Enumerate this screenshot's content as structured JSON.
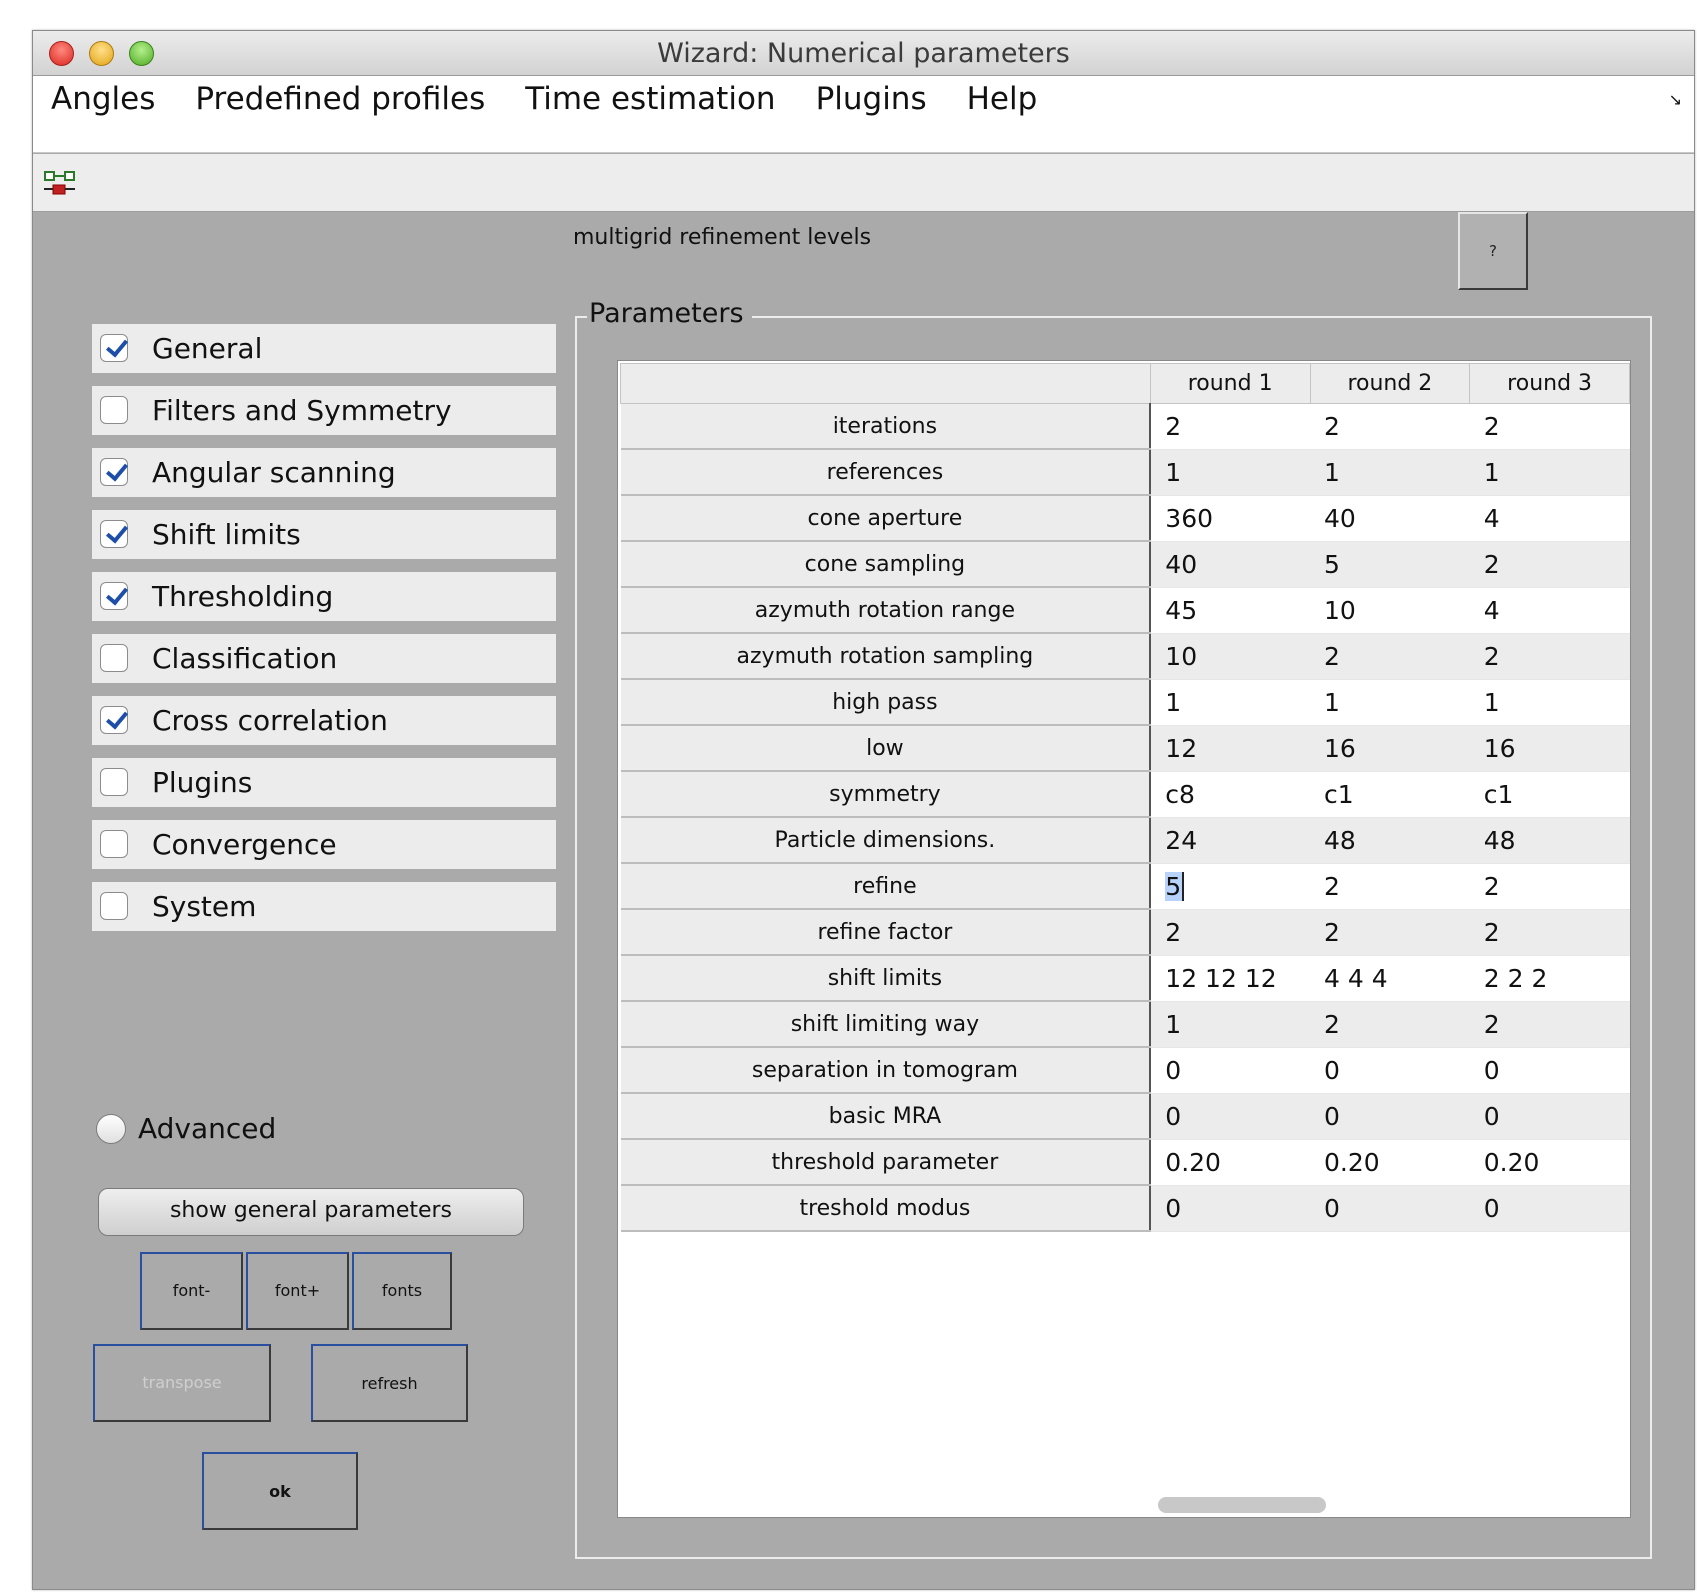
{
  "window": {
    "title": "Wizard: Numerical parameters"
  },
  "menu": {
    "items": [
      "Angles",
      "Predefined profiles",
      "Time estimation",
      "Plugins",
      "Help"
    ]
  },
  "toolbar": {
    "icon": "node-link-icon"
  },
  "header": {
    "multigrid_label": "multigrid refinement levels",
    "help_label": "?"
  },
  "categories": [
    {
      "label": "General",
      "checked": true
    },
    {
      "label": "Filters and Symmetry",
      "checked": false
    },
    {
      "label": "Angular scanning",
      "checked": true
    },
    {
      "label": "Shift limits",
      "checked": true
    },
    {
      "label": "Thresholding",
      "checked": true
    },
    {
      "label": "Classification",
      "checked": false
    },
    {
      "label": "Cross correlation",
      "checked": true
    },
    {
      "label": "Plugins",
      "checked": false
    },
    {
      "label": "Convergence",
      "checked": false
    },
    {
      "label": "System",
      "checked": false
    }
  ],
  "advanced": {
    "label": "Advanced",
    "selected": false
  },
  "buttons": {
    "show_general": "show general parameters",
    "font_minus": "font-",
    "font_plus": "font+",
    "fonts": "fonts",
    "transpose": "transpose",
    "refresh": "refresh",
    "ok": "ok"
  },
  "params": {
    "title": "Parameters",
    "columns": [
      "round 1",
      "round 2",
      "round 3"
    ],
    "rows": [
      {
        "label": "iterations",
        "values": [
          "2",
          "2",
          "2"
        ]
      },
      {
        "label": "references",
        "values": [
          "1",
          "1",
          "1"
        ]
      },
      {
        "label": "cone aperture",
        "values": [
          "360",
          "40",
          "4"
        ]
      },
      {
        "label": "cone sampling",
        "values": [
          "40",
          "5",
          "2"
        ]
      },
      {
        "label": "azymuth rotation range",
        "values": [
          "45",
          "10",
          "4"
        ]
      },
      {
        "label": "azymuth rotation sampling",
        "values": [
          "10",
          "2",
          "2"
        ]
      },
      {
        "label": "high pass",
        "values": [
          "1",
          "1",
          "1"
        ]
      },
      {
        "label": "low",
        "values": [
          "12",
          "16",
          "16"
        ]
      },
      {
        "label": "symmetry",
        "values": [
          "c8",
          "c1",
          "c1"
        ]
      },
      {
        "label": "Particle dimensions.",
        "values": [
          "24",
          "48",
          "48"
        ]
      },
      {
        "label": "refine",
        "values": [
          "5",
          "2",
          "2"
        ]
      },
      {
        "label": "refine factor",
        "values": [
          "2",
          "2",
          "2"
        ]
      },
      {
        "label": "shift limits",
        "values": [
          "12 12 12",
          "4 4 4",
          "2 2 2"
        ]
      },
      {
        "label": "shift limiting way",
        "values": [
          "1",
          "2",
          "2"
        ]
      },
      {
        "label": "separation in tomogram",
        "values": [
          "0",
          "0",
          "0"
        ]
      },
      {
        "label": "basic MRA",
        "values": [
          "0",
          "0",
          "0"
        ]
      },
      {
        "label": "threshold parameter",
        "values": [
          "0.20",
          "0.20",
          "0.20"
        ]
      },
      {
        "label": "treshold modus",
        "values": [
          "0",
          "0",
          "0"
        ]
      }
    ],
    "selected_cell": {
      "row": 10,
      "col": 0
    }
  },
  "colors": {
    "window_bg": "#aaaaaa",
    "panel_bg": "#ececec",
    "check": "#1e4fa8",
    "selection": "#b7d3fb"
  }
}
